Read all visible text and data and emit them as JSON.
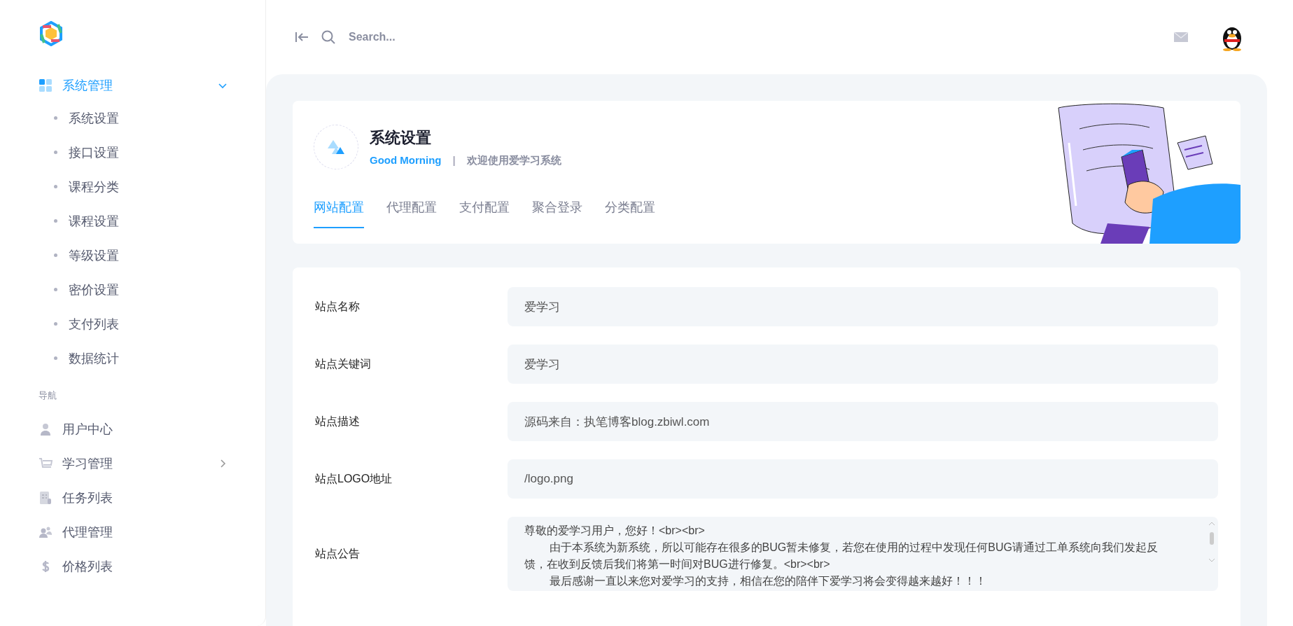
{
  "sidebar": {
    "menu": [
      {
        "label": "系统管理",
        "selected": true,
        "expanded": true,
        "children": [
          {
            "label": "系统设置",
            "selected": false
          },
          {
            "label": "接口设置",
            "selected": false
          },
          {
            "label": "课程分类",
            "selected": false
          },
          {
            "label": "课程设置",
            "selected": false
          },
          {
            "label": "等级设置",
            "selected": false
          },
          {
            "label": "密价设置",
            "selected": false
          },
          {
            "label": "支付列表",
            "selected": false
          },
          {
            "label": "数据统计",
            "selected": false
          }
        ]
      }
    ],
    "section_title": "导航",
    "nav": [
      {
        "kind": "link",
        "label": "用户中心"
      },
      {
        "kind": "submenu",
        "label": "学习管理"
      },
      {
        "kind": "link",
        "label": "任务列表"
      },
      {
        "kind": "link",
        "label": "代理管理"
      },
      {
        "kind": "link",
        "label": "价格列表"
      }
    ]
  },
  "topbar": {
    "search": {
      "placeholder": "Search..."
    }
  },
  "page_header": {
    "title": "系统设置",
    "greeting": "Good Morning",
    "separator": "|",
    "welcome": "欢迎使用爱学习系统",
    "tabs": [
      {
        "label": "网站配置",
        "selected": true
      },
      {
        "label": "代理配置",
        "selected": false
      },
      {
        "label": "支付配置",
        "selected": false
      },
      {
        "label": "聚合登录",
        "selected": false
      },
      {
        "label": "分类配置",
        "selected": false
      }
    ]
  },
  "form": {
    "fields": [
      {
        "kind": "input",
        "label": "站点名称",
        "value": "爱学习"
      },
      {
        "kind": "input",
        "label": "站点关键词",
        "value": "爱学习"
      },
      {
        "kind": "input",
        "label": "站点描述",
        "value": "源码来自：执笔博客blog.zbiwl.com"
      },
      {
        "kind": "input",
        "label": "站点LOGO地址",
        "value": "/logo.png"
      },
      {
        "kind": "textarea",
        "label": "站点公告",
        "lines": [
          "尊敬的爱学习用户，您好！<br><br>",
          "        由于本系统为新系统，所以可能存在很多的BUG暂未修复，若您在使用的过程中发现任何BUG请通过工单系统向我们发起反馈，在收到反馈后我们将第一时间对BUG进行修复。<br><br>",
          "        最后感谢一直以来您对爱学习的支持，相信在您的陪伴下爱学习将会变得越来越好！！！"
        ]
      }
    ]
  }
}
